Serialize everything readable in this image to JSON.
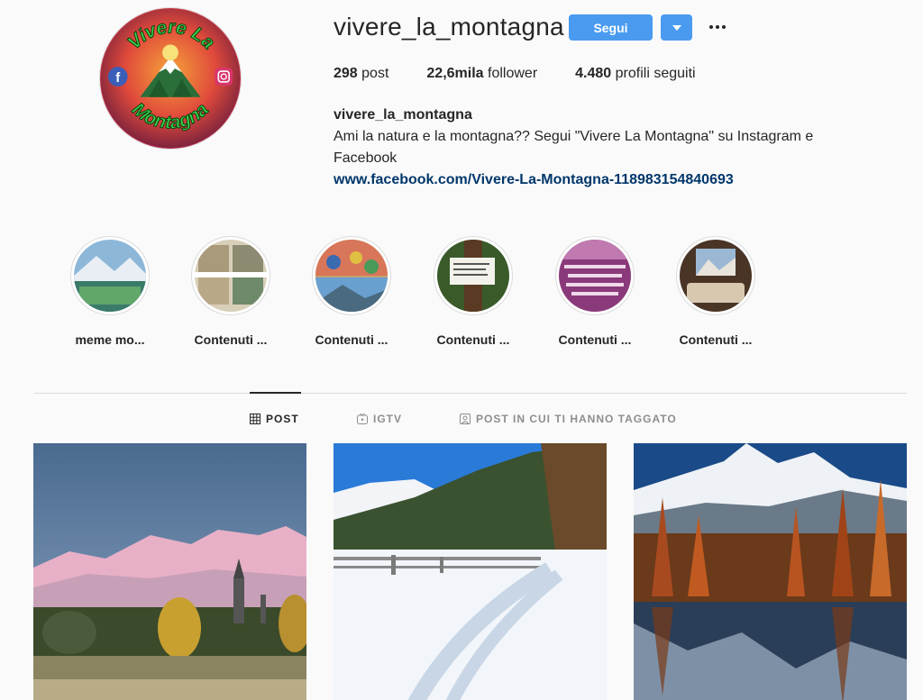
{
  "profile": {
    "username": "vivere_la_montagna",
    "follow_label": "Segui",
    "avatar_text": {
      "line1": "Vivere La",
      "line2": "Montagna"
    },
    "stats": [
      {
        "value": "298",
        "label": "post"
      },
      {
        "value": "22,6mila",
        "label": "follower"
      },
      {
        "value": "4.480",
        "label": "profili seguiti"
      }
    ],
    "bio": {
      "name": "vivere_la_montagna",
      "text": "Ami la natura e la montagna?? Segui \"Vivere La Montagna\" su Instagram e Facebook",
      "link": "www.facebook.com/Vivere-La-Montagna-118983154840693"
    }
  },
  "highlights": [
    {
      "label": "meme mo..."
    },
    {
      "label": "Contenuti ..."
    },
    {
      "label": "Contenuti ..."
    },
    {
      "label": "Contenuti ..."
    },
    {
      "label": "Contenuti ..."
    },
    {
      "label": "Contenuti ..."
    }
  ],
  "tabs": [
    {
      "label": "POST",
      "icon": "grid-icon",
      "active": true
    },
    {
      "label": "IGTV",
      "icon": "igtv-icon",
      "active": false
    },
    {
      "label": "POST IN CUI TI HANNO TAGGATO",
      "icon": "tagged-icon",
      "active": false
    }
  ],
  "colors": {
    "accent": "#4a9bf0",
    "link": "#00376b",
    "text": "#262626",
    "muted": "#8e8e8e"
  }
}
